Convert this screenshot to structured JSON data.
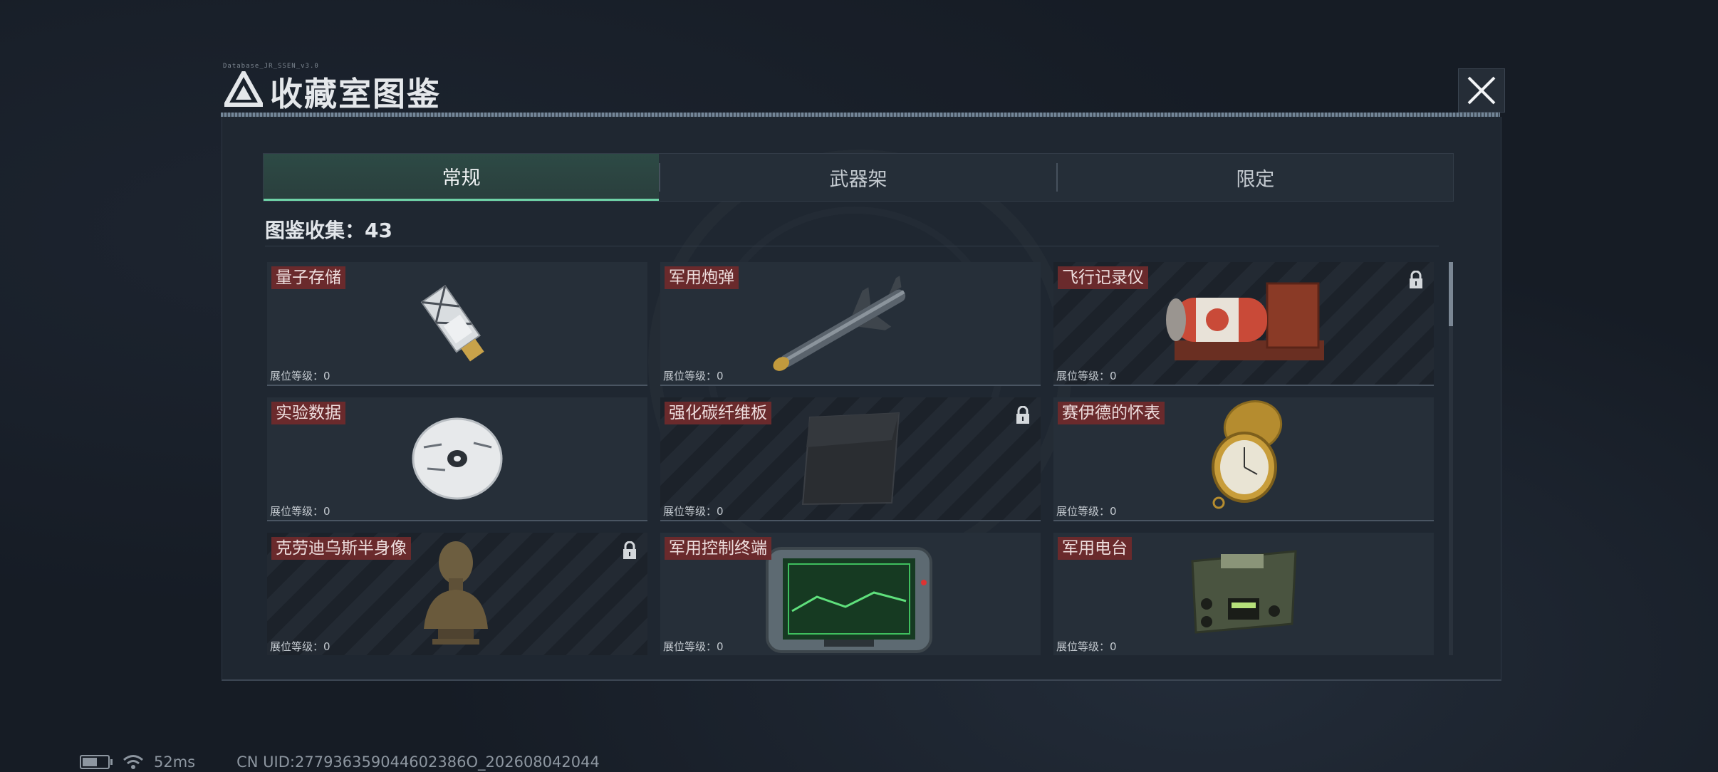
{
  "window": {
    "title": "收藏室图鉴",
    "title_tag": "Database_JR_SSEN_v3.0"
  },
  "tabs": [
    {
      "label": "常规",
      "active": true
    },
    {
      "label": "武器架",
      "active": false
    },
    {
      "label": "限定",
      "active": false
    }
  ],
  "collection": {
    "label": "图鉴收集：43"
  },
  "items": [
    {
      "name": "量子存储",
      "level": "展位等级：0",
      "locked": false,
      "icon": "usb-drive-icon"
    },
    {
      "name": "军用炮弹",
      "level": "展位等级：0",
      "locked": false,
      "icon": "missile-icon"
    },
    {
      "name": "飞行记录仪",
      "level": "展位等级：0",
      "locked": true,
      "icon": "flight-recorder-icon"
    },
    {
      "name": "实验数据",
      "level": "展位等级：0",
      "locked": false,
      "icon": "disc-icon"
    },
    {
      "name": "强化碳纤维板",
      "level": "展位等级：0",
      "locked": true,
      "icon": "carbon-plate-icon"
    },
    {
      "name": "赛伊德的怀表",
      "level": "展位等级：0",
      "locked": false,
      "icon": "pocket-watch-icon"
    },
    {
      "name": "克劳迪乌斯半身像",
      "level": "展位等级：0",
      "locked": true,
      "icon": "bust-icon"
    },
    {
      "name": "军用控制终端",
      "level": "展位等级：0",
      "locked": false,
      "icon": "control-terminal-icon"
    },
    {
      "name": "军用电台",
      "level": "展位等级：0",
      "locked": false,
      "icon": "radio-icon"
    }
  ],
  "status": {
    "ping": "52ms",
    "uid": "CN UID:277936359044602386O_202608042044"
  },
  "colors": {
    "accent": "#6fd3a7",
    "name_badge": "#6a2a2c",
    "panel": "#1f2731"
  }
}
